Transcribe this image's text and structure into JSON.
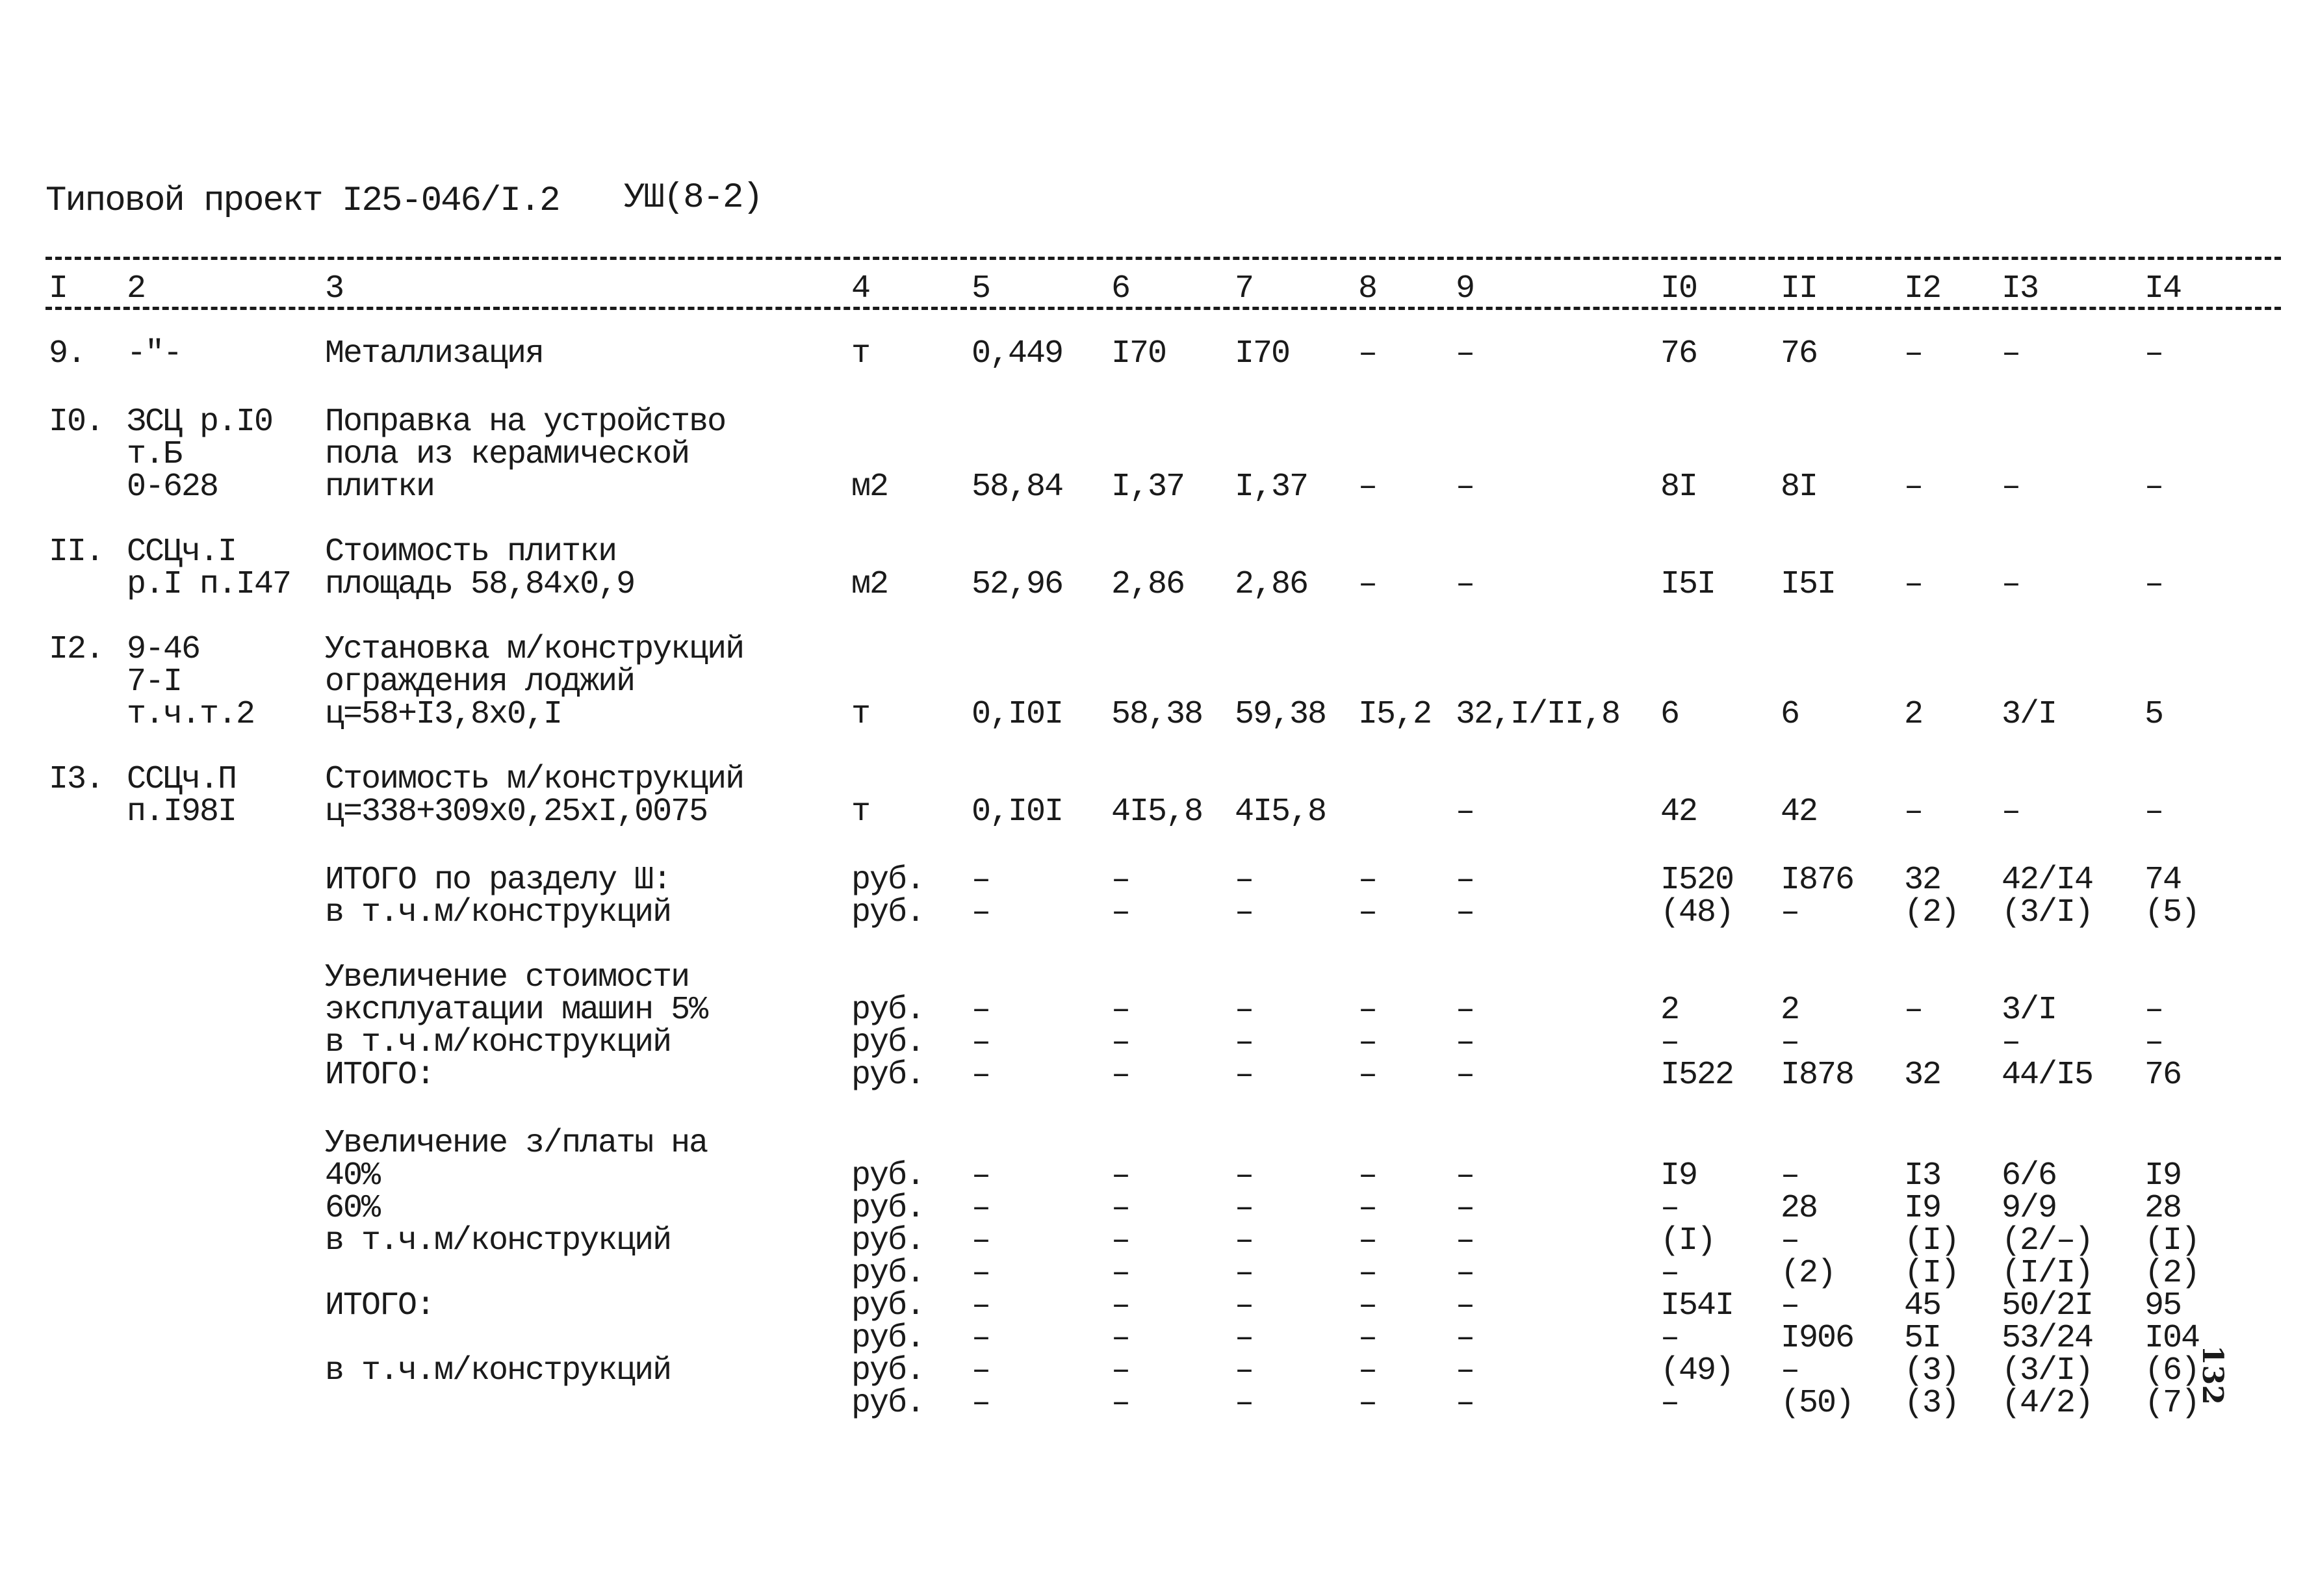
{
  "header": {
    "title": "Типовой проект I25-046/I.2",
    "section_mark": "УШ(8-2)"
  },
  "columns": [
    "I",
    "2",
    "3",
    "4",
    "5",
    "6",
    "7",
    "8",
    "9",
    "I0",
    "II",
    "I2",
    "I3",
    "I4"
  ],
  "rows": [
    {
      "num": "9.",
      "ref": [
        "-\"-"
      ],
      "name": [
        "Металлизация"
      ],
      "unit": "т",
      "c5": "0,449",
      "c6": "I70",
      "c7": "I70",
      "c8": "–",
      "c9": "–",
      "c10": "76",
      "c11": "76",
      "c12": "–",
      "c13": "–",
      "c14": "–"
    },
    {
      "num": "I0.",
      "ref": [
        "ЗСЦ р.I0",
        "т.Б",
        "0-628"
      ],
      "name": [
        "Поправка на устройство",
        "пола из керамической",
        "плитки"
      ],
      "unit": "м2",
      "c5": "58,84",
      "c6": "I,37",
      "c7": "I,37",
      "c8": "–",
      "c9": "–",
      "c10": "8I",
      "c11": "8I",
      "c12": "–",
      "c13": "–",
      "c14": "–"
    },
    {
      "num": "II.",
      "ref": [
        "ССЦч.I",
        "р.I п.I47"
      ],
      "name": [
        "Стоимость плитки",
        "площадь 58,84х0,9"
      ],
      "unit": "м2",
      "c5": "52,96",
      "c6": "2,86",
      "c7": "2,86",
      "c8": "–",
      "c9": "–",
      "c10": "I5I",
      "c11": "I5I",
      "c12": "–",
      "c13": "–",
      "c14": "–"
    },
    {
      "num": "I2.",
      "ref": [
        "9-46",
        "7-I",
        "т.ч.т.2"
      ],
      "name": [
        "Установка м/конструкций",
        "ограждения лоджий",
        "ц=58+I3,8х0,I"
      ],
      "unit": "т",
      "c5": "0,I0I",
      "c6": "58,38",
      "c7": "59,38",
      "c8": "I5,2",
      "c9": "32,I/II,8",
      "c10": "6",
      "c11": "6",
      "c12": "2",
      "c13": "3/I",
      "c14": "5"
    },
    {
      "num": "I3.",
      "ref": [
        "ССЦч.П",
        "п.I98I"
      ],
      "name": [
        "Стоимость м/конструкций",
        "ц=338+309х0,25хI,0075"
      ],
      "unit": "т",
      "c5": "0,I0I",
      "c6": "4I5,8",
      "c7": "4I5,8",
      "c8": "",
      "c9": "–",
      "c10": "42",
      "c11": "42",
      "c12": "–",
      "c13": "–",
      "c14": "–"
    }
  ],
  "totals": [
    {
      "labels": [
        "ИТОГО по разделу Ш:",
        "в т.ч.м/конструкций"
      ],
      "units": [
        "руб.",
        "руб."
      ],
      "c5": [
        "–",
        "–"
      ],
      "c6": [
        "–",
        "–"
      ],
      "c7": [
        "–",
        "–"
      ],
      "c8": [
        "–",
        "–"
      ],
      "c9": [
        "–",
        "–"
      ],
      "c10": [
        "I520",
        "(48)"
      ],
      "c11": [
        "I876",
        "–"
      ],
      "c12": [
        "32",
        "(2)"
      ],
      "c13": [
        "42/I4",
        "(3/I)"
      ],
      "c14": [
        "74",
        "(5)"
      ]
    },
    {
      "labels": [
        "Увеличение стоимости",
        "эксплуатации машин 5%",
        "в т.ч.м/конструкций",
        "ИТОГО:"
      ],
      "units": [
        "",
        "руб.",
        "руб.",
        "руб."
      ],
      "c5": [
        "",
        "–",
        "–",
        "–"
      ],
      "c6": [
        "",
        "–",
        "–",
        "–"
      ],
      "c7": [
        "",
        "–",
        "–",
        "–"
      ],
      "c8": [
        "",
        "–",
        "–",
        "–"
      ],
      "c9": [
        "",
        "–",
        "–",
        "–"
      ],
      "c10": [
        "",
        "2",
        "–",
        "I522"
      ],
      "c11": [
        "",
        "2",
        "–",
        "I878"
      ],
      "c12": [
        "",
        "–",
        "",
        "32"
      ],
      "c13": [
        "",
        "3/I",
        "–",
        "44/I5"
      ],
      "c14": [
        "",
        "–",
        "–",
        "76"
      ]
    },
    {
      "labels": [
        "Увеличение з/платы на",
        "40%",
        "60%",
        "в т.ч.м/конструкций",
        "",
        "ИТОГО:",
        "",
        "в т.ч.м/конструкций",
        ""
      ],
      "units": [
        "",
        "руб.",
        "руб.",
        "руб.",
        "руб.",
        "руб.",
        "руб.",
        "руб.",
        "руб."
      ],
      "c5": [
        "",
        "–",
        "–",
        "–",
        "–",
        "–",
        "–",
        "–",
        "–"
      ],
      "c6": [
        "",
        "–",
        "–",
        "–",
        "–",
        "–",
        "–",
        "–",
        "–"
      ],
      "c7": [
        "",
        "–",
        "–",
        "–",
        "–",
        "–",
        "–",
        "–",
        "–"
      ],
      "c8": [
        "",
        "–",
        "–",
        "–",
        "–",
        "–",
        "–",
        "–",
        "–"
      ],
      "c9": [
        "",
        "–",
        "–",
        "–",
        "–",
        "–",
        "–",
        "–",
        "–"
      ],
      "c10": [
        "",
        "I9",
        "–",
        "(I)",
        "–",
        "I54I",
        "–",
        "(49)",
        "–"
      ],
      "c11": [
        "",
        "–",
        "28",
        "–",
        "(2)",
        "–",
        "I906",
        "–",
        "(50)"
      ],
      "c12": [
        "",
        "I3",
        "I9",
        "(I)",
        "(I)",
        "45",
        "5I",
        "(3)",
        "(3)"
      ],
      "c13": [
        "",
        "6/6",
        "9/9",
        "(2/–)",
        "(I/I)",
        "50/2I",
        "53/24",
        "(3/I)",
        "(4/2)"
      ],
      "c14": [
        "",
        "I9",
        "28",
        "(I)",
        "(2)",
        "95",
        "I04",
        "(6)",
        "(7)"
      ]
    }
  ],
  "page_number": "132"
}
